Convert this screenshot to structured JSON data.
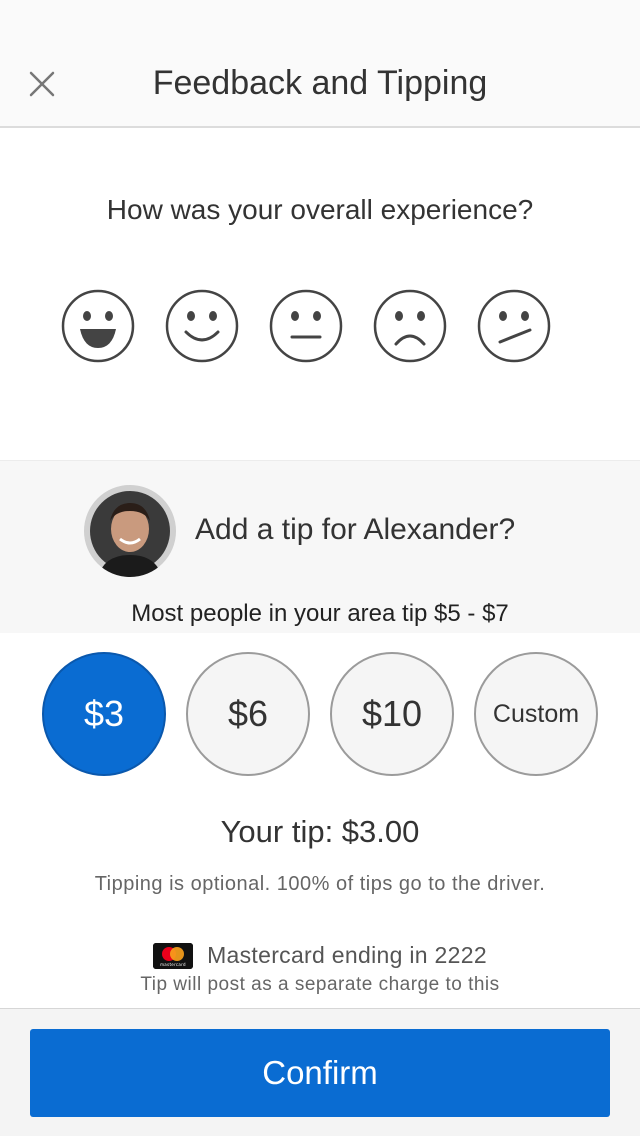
{
  "header": {
    "title": "Feedback and Tipping",
    "close_icon": "close-icon"
  },
  "rating": {
    "question": "How was your overall experience?",
    "faces": [
      {
        "icon": "very-happy-face-icon"
      },
      {
        "icon": "happy-face-icon"
      },
      {
        "icon": "neutral-face-icon"
      },
      {
        "icon": "sad-face-icon"
      },
      {
        "icon": "skeptical-face-icon"
      }
    ]
  },
  "tip": {
    "question": "Add a tip for Alexander?",
    "hint": "Most people in your area tip $5 - $7",
    "options": [
      {
        "label": "$3",
        "selected": true
      },
      {
        "label": "$6",
        "selected": false
      },
      {
        "label": "$10",
        "selected": false
      },
      {
        "label": "Custom",
        "selected": false
      }
    ],
    "your_tip": "Your tip: $3.00",
    "optional_note": "Tipping is optional. 100% of tips go to the driver.",
    "payment_method": "Mastercard ending in 2222",
    "payment_logo_text": "mastercard",
    "charge_note": "Tip will post as a separate charge to this"
  },
  "footer": {
    "confirm_label": "Confirm"
  },
  "colors": {
    "accent": "#0a6cd2",
    "selected_tip_bg": "#0a6cd2"
  }
}
